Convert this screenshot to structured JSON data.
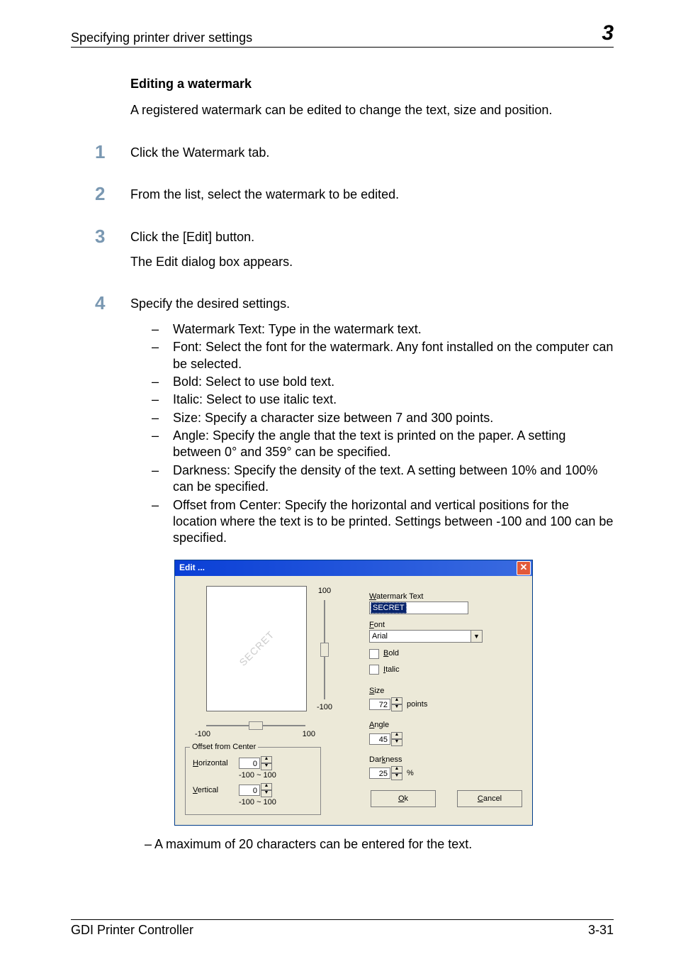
{
  "header": {
    "running_head": "Specifying printer driver settings",
    "chapter_number": "3"
  },
  "section": {
    "heading": "Editing a watermark",
    "intro": "A registered watermark can be edited to change the text, size and position."
  },
  "steps": [
    {
      "num": "1",
      "lines": [
        "Click the Watermark tab."
      ],
      "bullets": []
    },
    {
      "num": "2",
      "lines": [
        "From the list, select the watermark to be edited."
      ],
      "bullets": []
    },
    {
      "num": "3",
      "lines": [
        "Click the [Edit] button.",
        "The Edit dialog box appears."
      ],
      "bullets": []
    },
    {
      "num": "4",
      "lines": [
        "Specify the desired settings."
      ],
      "bullets": [
        "Watermark Text: Type in the watermark text.",
        "Font: Select the font for the watermark. Any font installed on the computer can be selected.",
        "Bold: Select to use bold text.",
        "Italic: Select to use italic text.",
        "Size: Specify a character size between 7 and 300 points.",
        "Angle: Specify the angle that the text is printed on the paper. A setting between 0° and 359° can be specified.",
        "Darkness: Specify the density of the text. A setting between 10% and 100% can be specified.",
        "Offset from Center: Specify the horizontal and vertical positions for the location where the text is to be printed. Settings between -100 and 100 can be specified."
      ]
    }
  ],
  "dialog": {
    "title": "Edit ...",
    "preview_watermark": "SECRET",
    "vslider": {
      "max_label": "100",
      "min_label": "-100"
    },
    "hslider": {
      "min_label": "-100",
      "max_label": "100"
    },
    "offset_group": {
      "title": "Offset from Center",
      "horizontal_label": "Horizontal",
      "horizontal_value": "0",
      "horizontal_range": "-100 ~ 100",
      "vertical_label": "Vertical",
      "vertical_value": "0",
      "vertical_range": "-100 ~ 100"
    },
    "watermark_text_label": "Watermark Text",
    "watermark_text_value": "SECRET",
    "font_label": "Font",
    "font_value": "Arial",
    "bold_label": "Bold",
    "italic_label": "Italic",
    "size_label": "Size",
    "size_value": "72",
    "size_unit": "points",
    "angle_label": "Angle",
    "angle_value": "45",
    "darkness_label": "Darkness",
    "darkness_value": "25",
    "darkness_unit": "%",
    "ok_label": "Ok",
    "cancel_label": "Cancel"
  },
  "post_note": "A maximum of 20 characters can be entered for the text.",
  "footer": {
    "left": "GDI Printer Controller",
    "right": "3-31"
  }
}
